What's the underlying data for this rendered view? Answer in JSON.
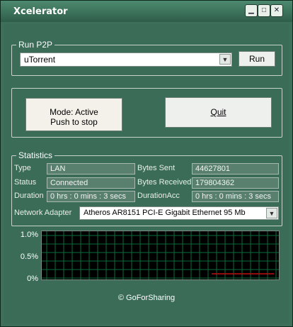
{
  "window": {
    "title": "Xcelerator"
  },
  "run_p2p": {
    "group_label": "Run P2P",
    "selected": "uTorrent",
    "run_label": "Run"
  },
  "mode": {
    "line1": "Mode: Active",
    "line2": "Push to stop",
    "quit_label": "Quit"
  },
  "statistics": {
    "group_label": "Statistics",
    "type_label": "Type",
    "type_value": "LAN",
    "status_label": "Status",
    "status_value": "Connected",
    "duration_label": "Duration",
    "duration_value": "0 hrs :  0 mins :  3 secs",
    "bytes_sent_label": "Bytes Sent",
    "bytes_sent_value": "44627801",
    "bytes_received_label": "Bytes Received",
    "bytes_received_value": "179804362",
    "duration_acc_label": "DurationAcc",
    "duration_acc_value": "0 hrs :  0 mins :  3 secs",
    "adapter_label": "Network Adapter",
    "adapter_value": "Atheros AR8151 PCI-E Gigabit Ethernet  95 Mb"
  },
  "graph": {
    "y_labels": [
      "1.0%",
      "0.5%",
      "0%"
    ],
    "grid_color": "#0a6b3c",
    "line_color": "#c01010"
  },
  "footer": {
    "copyright": "© GoForSharing"
  },
  "colors": {
    "window_bg": "#3b6c58",
    "titlebar": "#2f5d49"
  }
}
